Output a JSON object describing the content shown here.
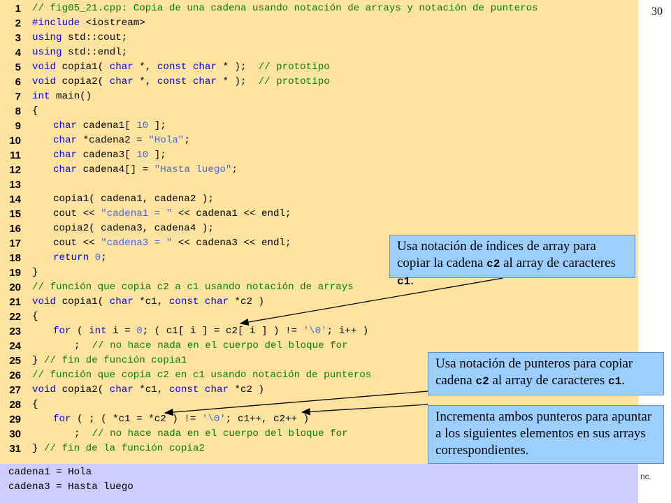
{
  "slide": {
    "page_number": "30",
    "copyright_fragment": "nc."
  },
  "code_lines": [
    {
      "n": "1",
      "indent": 0,
      "segs": [
        {
          "t": "// fig05_21.cpp: Copia de una cadena usando notación de arrays y notación de punteros",
          "c": "cm"
        }
      ]
    },
    {
      "n": "2",
      "indent": 0,
      "segs": [
        {
          "t": "#include",
          "c": "kw"
        },
        {
          "t": " <iostream>",
          "c": ""
        }
      ]
    },
    {
      "n": "3",
      "indent": 0,
      "segs": [
        {
          "t": "using",
          "c": "kw"
        },
        {
          "t": " std::cout;",
          "c": ""
        }
      ]
    },
    {
      "n": "4",
      "indent": 0,
      "segs": [
        {
          "t": "using",
          "c": "kw"
        },
        {
          "t": " std::endl;",
          "c": ""
        }
      ]
    },
    {
      "n": "5",
      "indent": 0,
      "segs": [
        {
          "t": "void",
          "c": "kw"
        },
        {
          "t": " copia1( ",
          "c": ""
        },
        {
          "t": "char",
          "c": "kw"
        },
        {
          "t": " *, ",
          "c": ""
        },
        {
          "t": "const char",
          "c": "kw"
        },
        {
          "t": " * );  ",
          "c": ""
        },
        {
          "t": "// prototipo",
          "c": "cm"
        }
      ]
    },
    {
      "n": "6",
      "indent": 0,
      "segs": [
        {
          "t": "void",
          "c": "kw"
        },
        {
          "t": " copia2( ",
          "c": ""
        },
        {
          "t": "char",
          "c": "kw"
        },
        {
          "t": " *, ",
          "c": ""
        },
        {
          "t": "const char",
          "c": "kw"
        },
        {
          "t": " * );  ",
          "c": ""
        },
        {
          "t": "// prototipo",
          "c": "cm"
        }
      ]
    },
    {
      "n": "7",
      "indent": 0,
      "segs": [
        {
          "t": "int",
          "c": "kw"
        },
        {
          "t": " main()",
          "c": ""
        }
      ]
    },
    {
      "n": "8",
      "indent": 0,
      "segs": [
        {
          "t": "{",
          "c": ""
        }
      ]
    },
    {
      "n": "9",
      "indent": 1,
      "segs": [
        {
          "t": "char",
          "c": "kw"
        },
        {
          "t": " cadena1[ ",
          "c": ""
        },
        {
          "t": "10",
          "c": "num"
        },
        {
          "t": " ];",
          "c": ""
        }
      ]
    },
    {
      "n": "10",
      "indent": 1,
      "segs": [
        {
          "t": "char",
          "c": "kw"
        },
        {
          "t": " *cadena2 = ",
          "c": ""
        },
        {
          "t": "\"Hola\"",
          "c": "str"
        },
        {
          "t": ";",
          "c": ""
        }
      ]
    },
    {
      "n": "11",
      "indent": 1,
      "segs": [
        {
          "t": "char",
          "c": "kw"
        },
        {
          "t": " cadena3[ ",
          "c": ""
        },
        {
          "t": "10",
          "c": "num"
        },
        {
          "t": " ];",
          "c": ""
        }
      ]
    },
    {
      "n": "12",
      "indent": 1,
      "segs": [
        {
          "t": "char",
          "c": "kw"
        },
        {
          "t": " cadena4[] = ",
          "c": ""
        },
        {
          "t": "\"Hasta luego\"",
          "c": "str"
        },
        {
          "t": ";",
          "c": ""
        }
      ]
    },
    {
      "n": "13",
      "indent": 0,
      "segs": []
    },
    {
      "n": "14",
      "indent": 1,
      "segs": [
        {
          "t": "copia1( cadena1, cadena2 );",
          "c": ""
        }
      ]
    },
    {
      "n": "15",
      "indent": 1,
      "segs": [
        {
          "t": "cout << ",
          "c": ""
        },
        {
          "t": "\"cadena1 = \"",
          "c": "str"
        },
        {
          "t": " << cadena1 << endl;",
          "c": ""
        }
      ]
    },
    {
      "n": "16",
      "indent": 1,
      "segs": [
        {
          "t": "copia2( cadena3, cadena4 );",
          "c": ""
        }
      ]
    },
    {
      "n": "17",
      "indent": 1,
      "segs": [
        {
          "t": "cout << ",
          "c": ""
        },
        {
          "t": "\"cadena3 = \"",
          "c": "str"
        },
        {
          "t": " << cadena3 << endl;",
          "c": ""
        }
      ]
    },
    {
      "n": "18",
      "indent": 1,
      "segs": [
        {
          "t": "return",
          "c": "kw"
        },
        {
          "t": " ",
          "c": ""
        },
        {
          "t": "0",
          "c": "num"
        },
        {
          "t": ";",
          "c": ""
        }
      ]
    },
    {
      "n": "19",
      "indent": 0,
      "segs": [
        {
          "t": "}",
          "c": ""
        }
      ]
    },
    {
      "n": "20",
      "indent": 0,
      "segs": [
        {
          "t": "// función que copia c2 a c1 usando notación de arrays",
          "c": "cm"
        }
      ]
    },
    {
      "n": "21",
      "indent": 0,
      "segs": [
        {
          "t": "void",
          "c": "kw"
        },
        {
          "t": " copia1( ",
          "c": ""
        },
        {
          "t": "char",
          "c": "kw"
        },
        {
          "t": " *c1, ",
          "c": ""
        },
        {
          "t": "const char",
          "c": "kw"
        },
        {
          "t": " *c2 )",
          "c": ""
        }
      ]
    },
    {
      "n": "22",
      "indent": 0,
      "segs": [
        {
          "t": "{",
          "c": ""
        }
      ]
    },
    {
      "n": "23",
      "indent": 1,
      "segs": [
        {
          "t": "for",
          "c": "kw"
        },
        {
          "t": " ( ",
          "c": ""
        },
        {
          "t": "int",
          "c": "kw"
        },
        {
          "t": " i = ",
          "c": ""
        },
        {
          "t": "0",
          "c": "num"
        },
        {
          "t": "; ( c1[ i ] = c2[ i ] ) != ",
          "c": ""
        },
        {
          "t": "'\\0'",
          "c": "str"
        },
        {
          "t": "; i++ )",
          "c": ""
        }
      ]
    },
    {
      "n": "24",
      "indent": 2,
      "segs": [
        {
          "t": ";  ",
          "c": ""
        },
        {
          "t": "// no hace nada en el cuerpo del bloque for",
          "c": "cm"
        }
      ]
    },
    {
      "n": "25",
      "indent": 0,
      "segs": [
        {
          "t": "} ",
          "c": ""
        },
        {
          "t": "// fin de función copia1",
          "c": "cm"
        }
      ]
    },
    {
      "n": "26",
      "indent": 0,
      "segs": [
        {
          "t": "// función que copia c2 en c1 usando notación de punteros",
          "c": "cm"
        }
      ]
    },
    {
      "n": "27",
      "indent": 0,
      "segs": [
        {
          "t": "void",
          "c": "kw"
        },
        {
          "t": " copia2( ",
          "c": ""
        },
        {
          "t": "char",
          "c": "kw"
        },
        {
          "t": " *c1, ",
          "c": ""
        },
        {
          "t": "const char",
          "c": "kw"
        },
        {
          "t": " *c2 )",
          "c": ""
        }
      ]
    },
    {
      "n": "28",
      "indent": 0,
      "segs": [
        {
          "t": "{",
          "c": ""
        }
      ]
    },
    {
      "n": "29",
      "indent": 1,
      "segs": [
        {
          "t": "for",
          "c": "kw"
        },
        {
          "t": " ( ; ( *c1 = *c2 ) != ",
          "c": ""
        },
        {
          "t": "'\\0'",
          "c": "str"
        },
        {
          "t": "; c1++, c2++ )",
          "c": ""
        }
      ]
    },
    {
      "n": "30",
      "indent": 2,
      "segs": [
        {
          "t": ";  ",
          "c": ""
        },
        {
          "t": "// no hace nada en el cuerpo del bloque for",
          "c": "cm"
        }
      ]
    },
    {
      "n": "31",
      "indent": 0,
      "segs": [
        {
          "t": "} ",
          "c": ""
        },
        {
          "t": "// fin de la función copia2",
          "c": "cm"
        }
      ]
    }
  ],
  "output": [
    "cadena1 = Hola",
    "cadena3 = Hasta luego"
  ],
  "callouts": {
    "c1": {
      "pre": "Usa notación de índices de array para copiar la cadena ",
      "code1": "c2",
      "mid": " al array de caracteres ",
      "code2": "c1",
      "post": "."
    },
    "c2": {
      "pre": "Usa notación de punteros para copiar cadena ",
      "code1": "c2",
      "mid": " al array de caracteres ",
      "code2": "c1",
      "post": "."
    },
    "c3": {
      "text": "Incrementa ambos punteros para apuntar a los siguientes elementos en sus arrays correspondientes."
    }
  }
}
